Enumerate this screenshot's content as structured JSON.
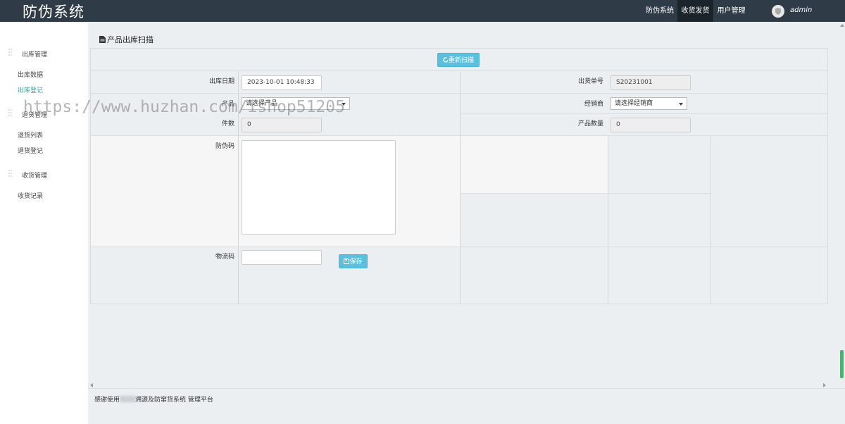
{
  "app": {
    "brand": "防伪系统"
  },
  "nav": {
    "items": [
      {
        "label": "防伪系统"
      },
      {
        "label": "收货发货",
        "active": true
      },
      {
        "label": "用户管理"
      }
    ],
    "user": "admin"
  },
  "sidebar": {
    "groups": [
      {
        "label": "出库管理",
        "items": [
          "出库数据",
          "出库登记"
        ]
      },
      {
        "label": "退货管理",
        "items": [
          "退货列表",
          "退货登记"
        ]
      },
      {
        "label": "收货管理",
        "items": [
          "收货记录"
        ]
      }
    ],
    "active_item": "出库登记"
  },
  "page": {
    "title": "产品出库扫描"
  },
  "form": {
    "rescan_button": "重新扫描",
    "date_label": "出库日期",
    "date_value": "2023-10-01 10:48:33",
    "order_label": "出货单号",
    "order_value": "S20231001",
    "product_label": "产品",
    "product_select": "请选择产品",
    "dealer_label": "经销商",
    "dealer_select": "请选择经销商",
    "pieces_label": "件数",
    "pieces_value": "0",
    "quantity_label": "产品数量",
    "quantity_value": "0",
    "antifake_label": "防伪码",
    "logistics_label": "物流码",
    "save_button": "保存"
  },
  "footer": {
    "prefix": "感谢使用",
    "suffix": "溯源及防窜货系统 管理平台"
  },
  "watermark": "https://www.huzhan.com/ishop51205",
  "colors": {
    "navbar": "#2f3b47",
    "accent": "#5bc0de",
    "active_link": "#3a9e98",
    "scroll_thumb": "#3dbb6b"
  }
}
